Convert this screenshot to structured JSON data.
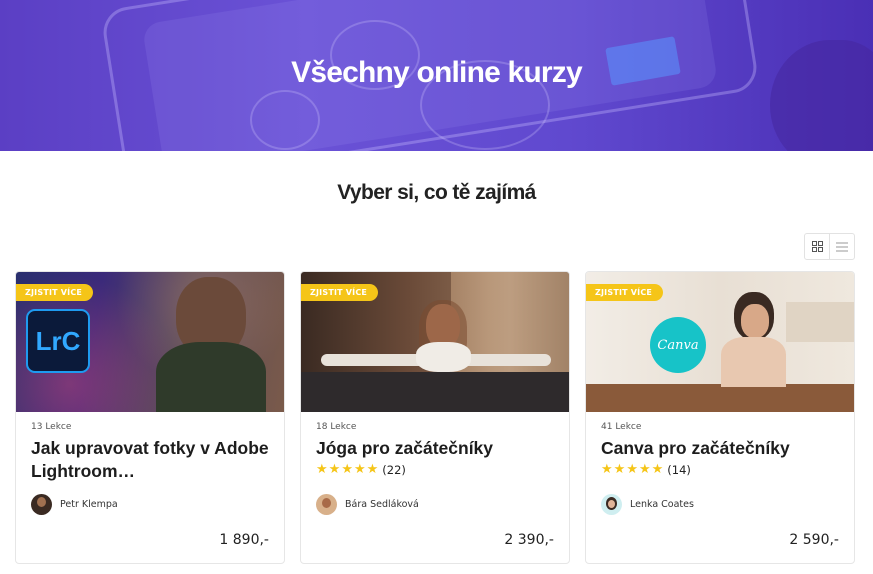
{
  "hero": {
    "title": "Všechny online kurzy"
  },
  "section": {
    "title": "Vyber si, co tě zajímá"
  },
  "view_toggle": {
    "grid_icon": "grid-icon",
    "list_icon": "list-icon"
  },
  "courses": [
    {
      "badge": "ZJISTIT VÍCE",
      "lessons": "13 Lekce",
      "title": "Jak upravovat fotky v Adobe Lightroom…",
      "thumb_logo": "LrC",
      "author": "Petr Klempa",
      "price": "1 890,-"
    },
    {
      "badge": "ZJISTIT VÍCE",
      "lessons": "18 Lekce",
      "title": "Jóga pro začátečníky",
      "rating_count": "(22)",
      "stars": 5,
      "author": "Bára Sedláková",
      "price": "2 390,-"
    },
    {
      "badge": "ZJISTIT VÍCE",
      "lessons": "41 Lekce",
      "title": "Canva pro začátečníky",
      "rating_count": "(14)",
      "stars": 5,
      "thumb_logo": "Canva",
      "author": "Lenka Coates",
      "price": "2 590,-"
    }
  ],
  "colors": {
    "accent": "#f5c518",
    "hero": "#6049cf"
  }
}
